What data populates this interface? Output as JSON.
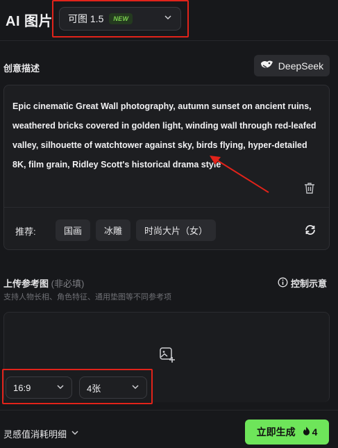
{
  "header": {
    "title": "AI 图片",
    "model": {
      "name": "可图 1.5",
      "badge": "NEW"
    }
  },
  "prompt_section": {
    "label": "创意描述",
    "deepseek_label": "DeepSeek",
    "prompt_text": "Epic cinematic Great Wall photography, autumn sunset on ancient ruins, weathered bricks covered in golden light, winding wall through red-leafed valley, silhouette of watchtower against sky, birds flying, hyper-detailed 8K, film grain, Ridley Scott's historical drama style",
    "recommend_label": "推荐:",
    "chips": [
      "国画",
      "冰雕",
      "时尚大片（女）"
    ]
  },
  "upload_section": {
    "label": "上传参考图",
    "optional": "(非必填)",
    "hint": "支持人物长相、角色特征、通用垫图等不同参考项",
    "control_hint": "控制示意"
  },
  "options": {
    "ratio": "16:9",
    "count": "4张"
  },
  "footer": {
    "cost_detail": "灵感值消耗明细",
    "generate_label": "立即生成",
    "cost": "4"
  },
  "colors": {
    "accent_green": "#6ee55a",
    "annotation_red": "#e2231a",
    "background": "#17181b"
  }
}
